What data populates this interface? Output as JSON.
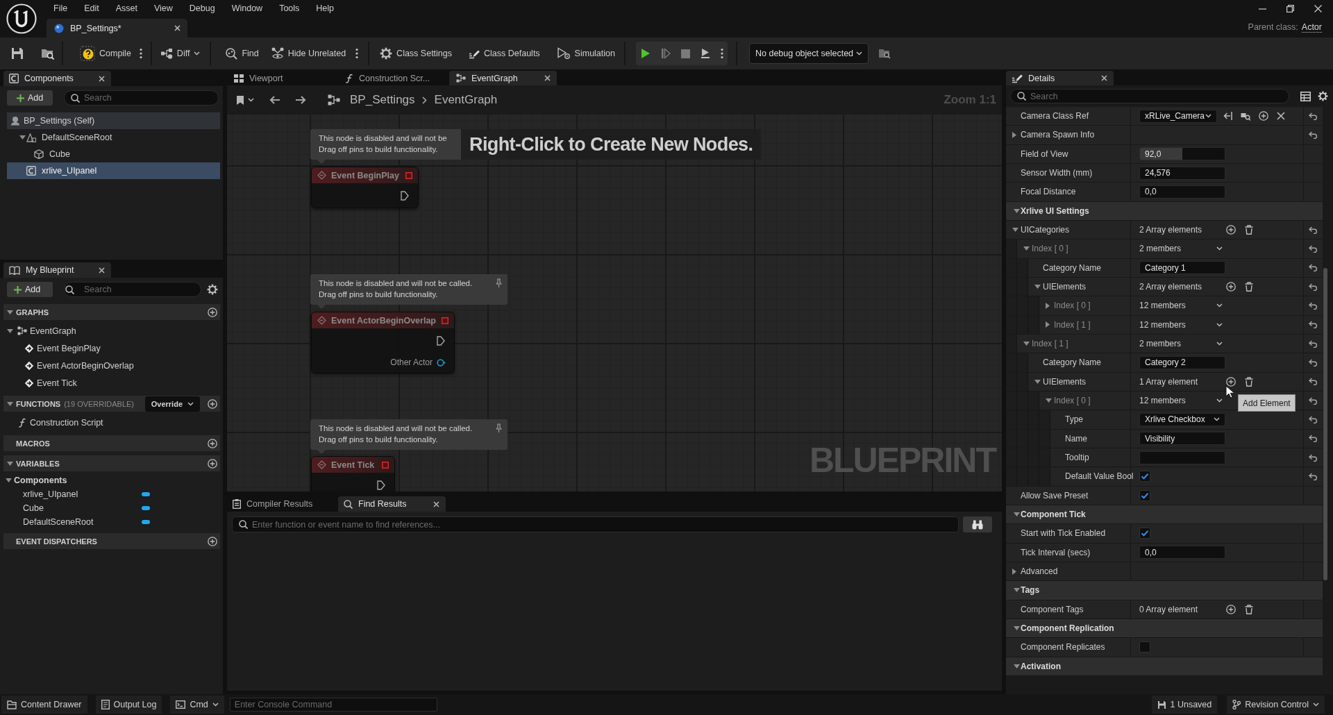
{
  "title_bar": {
    "menu": [
      "File",
      "Edit",
      "Asset",
      "View",
      "Debug",
      "Window",
      "Tools",
      "Help"
    ],
    "document_tab": "BP_Settings*",
    "parent_class": {
      "label": "Parent class:",
      "value": "Actor"
    }
  },
  "toolbar": {
    "compile": "Compile",
    "diff": "Diff",
    "find": "Find",
    "hide_unrelated": "Hide Unrelated",
    "class_settings": "Class Settings",
    "class_defaults": "Class Defaults",
    "simulation": "Simulation",
    "debug_object": "No debug object selected"
  },
  "components_panel": {
    "tab": "Components",
    "add_button": "Add",
    "search": {
      "placeholder": "Search"
    },
    "tree": [
      {
        "kind": "self",
        "label": "BP_Settings (Self)",
        "selected": false,
        "children": [
          {
            "kind": "scene",
            "label": "DefaultSceneRoot",
            "selected": false,
            "expanded": true,
            "children": [
              {
                "kind": "mesh",
                "label": "Cube",
                "selected": false
              }
            ]
          },
          {
            "kind": "component",
            "label": "xrlive_UIpanel",
            "selected": true
          }
        ]
      }
    ]
  },
  "my_blueprint": {
    "tab": "My Blueprint",
    "add_button": "Add",
    "search": {
      "placeholder": "Search"
    },
    "sections": [
      {
        "kind": "graphs",
        "title": "GRAPHS",
        "expanded": true,
        "items": [
          {
            "kind": "graph",
            "label": "EventGraph",
            "expanded": true,
            "children": [
              {
                "kind": "event",
                "label": "Event BeginPlay"
              },
              {
                "kind": "event",
                "label": "Event ActorBeginOverlap"
              },
              {
                "kind": "event",
                "label": "Event Tick"
              }
            ]
          }
        ]
      },
      {
        "kind": "functions",
        "title": "FUNCTIONS",
        "note": "(19 OVERRIDABLE)",
        "button": "Override",
        "expanded": true,
        "items": [
          {
            "kind": "function",
            "label": "Construction Script"
          }
        ]
      },
      {
        "kind": "macros",
        "title": "MACROS"
      },
      {
        "kind": "variables",
        "title": "VARIABLES",
        "expanded": true,
        "items": [
          {
            "kind": "group",
            "label": "Components",
            "expanded": true,
            "children": [
              {
                "kind": "variable",
                "label": "xrlive_UIpanel"
              },
              {
                "kind": "variable",
                "label": "Cube"
              },
              {
                "kind": "variable",
                "label": "DefaultSceneRoot"
              }
            ]
          }
        ]
      },
      {
        "kind": "dispatchers",
        "title": "EVENT DISPATCHERS"
      }
    ]
  },
  "graph_editor": {
    "tabs": [
      {
        "kind": "viewport",
        "label": "Viewport",
        "selected": false
      },
      {
        "kind": "function",
        "label": "Construction Scr...",
        "selected": false
      },
      {
        "kind": "graph",
        "label": "EventGraph",
        "selected": true
      }
    ],
    "breadcrumb": [
      "BP_Settings",
      "EventGraph"
    ],
    "zoom_label": "Zoom 1:1",
    "hint": "Right-Click to Create New Nodes.",
    "graph_type": "BLUEPRINT",
    "nodes": [
      {
        "title": "Event BeginPlay",
        "disabled": true,
        "comment": "This node is disabled and will not be\nDrag off pins to build functionality.",
        "pins": [
          {
            "kind": "exec"
          }
        ]
      },
      {
        "title": "Event ActorBeginOverlap",
        "disabled": true,
        "comment": "This node is disabled and will not be called.\nDrag off pins to build functionality.",
        "pins": [
          {
            "kind": "exec"
          },
          {
            "kind": "object",
            "label": "Other Actor"
          }
        ]
      },
      {
        "title": "Event Tick",
        "disabled": true,
        "comment": "This node is disabled and will not be called.\nDrag off pins to build functionality.",
        "pins": [
          {
            "kind": "exec"
          }
        ]
      }
    ]
  },
  "find_panel": {
    "tabs": [
      {
        "kind": "compiler",
        "label": "Compiler Results",
        "selected": false
      },
      {
        "kind": "find",
        "label": "Find Results",
        "selected": true
      }
    ],
    "search": {
      "placeholder": "Enter function or event name to find references..."
    }
  },
  "details": {
    "tab": "Details",
    "search": {
      "placeholder": "Search"
    },
    "rows": [
      {
        "kind": "property",
        "label": "Camera Class Ref",
        "value": {
          "kind": "asset",
          "text": "xRLive_Camera"
        },
        "reset": true
      },
      {
        "kind": "property",
        "label": "Camera Spawn Info",
        "expanded": false,
        "reset": true
      },
      {
        "kind": "property",
        "label": "Field of View",
        "value": {
          "kind": "slider",
          "text": "92,0",
          "level": 0.5
        },
        "reset": false
      },
      {
        "kind": "property",
        "label": "Sensor Width (mm)",
        "value": {
          "kind": "field",
          "text": "24,576"
        },
        "reset": false
      },
      {
        "kind": "property",
        "label": "Focal Distance",
        "value": {
          "kind": "field",
          "text": "0,0"
        },
        "reset": false
      },
      {
        "kind": "category",
        "label": "Xrlive UI Settings",
        "expanded": true,
        "children": [
          {
            "kind": "property",
            "label": "UICategories",
            "expanded": true,
            "value": {
              "kind": "array",
              "text": "2 Array elements"
            },
            "reset": true,
            "children": [
              {
                "kind": "element",
                "label": "Index [ 0 ]",
                "expanded": true,
                "value": {
                  "kind": "members",
                  "text": "2 members"
                },
                "reset": true,
                "children": [
                  {
                    "kind": "property",
                    "label": "Category Name",
                    "value": {
                      "kind": "field",
                      "text": "Category 1"
                    },
                    "reset": true
                  },
                  {
                    "kind": "property",
                    "label": "UIElements",
                    "expanded": true,
                    "value": {
                      "kind": "array",
                      "text": "2 Array elements"
                    },
                    "reset": true,
                    "children": [
                      {
                        "kind": "element",
                        "label": "Index [ 0 ]",
                        "expanded": false,
                        "value": {
                          "kind": "members",
                          "text": "12 members"
                        },
                        "reset": true
                      },
                      {
                        "kind": "element",
                        "label": "Index [ 1 ]",
                        "expanded": false,
                        "value": {
                          "kind": "members",
                          "text": "12 members"
                        },
                        "reset": true
                      }
                    ]
                  }
                ]
              },
              {
                "kind": "element",
                "label": "Index [ 1 ]",
                "expanded": true,
                "value": {
                  "kind": "members",
                  "text": "2 members"
                },
                "reset": true,
                "children": [
                  {
                    "kind": "property",
                    "label": "Category Name",
                    "value": {
                      "kind": "field",
                      "text": "Category 2"
                    },
                    "reset": true
                  },
                  {
                    "kind": "property",
                    "label": "UIElements",
                    "expanded": true,
                    "value": {
                      "kind": "array",
                      "text": "1 Array element"
                    },
                    "reset": true,
                    "children": [
                      {
                        "kind": "element",
                        "label": "Index [ 0 ]",
                        "expanded": true,
                        "value": {
                          "kind": "members",
                          "text": "12 members"
                        },
                        "reset": true,
                        "children": [
                          {
                            "kind": "property",
                            "label": "Type",
                            "value": {
                              "kind": "combo",
                              "text": "Xrlive Checkbox"
                            },
                            "reset": true
                          },
                          {
                            "kind": "property",
                            "label": "Name",
                            "value": {
                              "kind": "field",
                              "text": "Visibility"
                            },
                            "reset": true
                          },
                          {
                            "kind": "property",
                            "label": "Tooltip",
                            "value": {
                              "kind": "field"
                            },
                            "reset": true
                          },
                          {
                            "kind": "property",
                            "label": "Default Value Bool",
                            "value": {
                              "kind": "checkbox",
                              "checked": true
                            },
                            "reset": true
                          }
                        ]
                      }
                    ]
                  }
                ]
              }
            ]
          },
          {
            "kind": "property",
            "label": "Allow Save Preset",
            "value": {
              "kind": "checkbox",
              "checked": true
            },
            "reset": false
          }
        ]
      },
      {
        "kind": "category",
        "label": "Component Tick",
        "expanded": true,
        "children": [
          {
            "kind": "property",
            "label": "Start with Tick Enabled",
            "value": {
              "kind": "checkbox",
              "checked": true
            },
            "reset": false
          },
          {
            "kind": "property",
            "label": "Tick Interval (secs)",
            "value": {
              "kind": "field",
              "text": "0,0"
            },
            "reset": false
          },
          {
            "kind": "property",
            "label": "Advanced",
            "expanded": false,
            "reset": false
          }
        ]
      },
      {
        "kind": "category",
        "label": "Tags",
        "expanded": true,
        "children": [
          {
            "kind": "property",
            "label": "Component Tags",
            "value": {
              "kind": "array",
              "text": "0 Array element"
            },
            "reset": false
          }
        ]
      },
      {
        "kind": "category",
        "label": "Component Replication",
        "expanded": true,
        "children": [
          {
            "kind": "property",
            "label": "Component Replicates",
            "value": {
              "kind": "checkbox",
              "checked": false
            },
            "reset": false
          }
        ]
      },
      {
        "kind": "category",
        "label": "Activation",
        "expanded": true
      }
    ],
    "tooltip": "Add Element"
  },
  "status_bar": {
    "content_drawer": "Content Drawer",
    "output_log": "Output Log",
    "cmd": "Cmd",
    "console": {
      "placeholder": "Enter Console Command"
    },
    "unsaved": "1 Unsaved",
    "revision_control": "Revision Control"
  }
}
